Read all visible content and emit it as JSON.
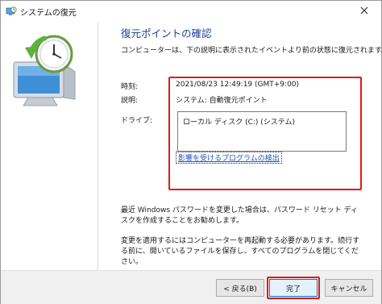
{
  "window": {
    "title": "システムの復元"
  },
  "heading": "復元ポイントの確認",
  "intro": "コンピューターは、下の説明に表示されたイベントより前の状態に復元されます。",
  "details": {
    "time_label": "時刻:",
    "time_value": "2021/08/23 12:49:19 (GMT+9:00)",
    "desc_label": "説明:",
    "desc_value": "システム: 自動復元ポイント",
    "drive_label": "ドライブ:",
    "drives": [
      "ローカル ディスク (C:) (システム)"
    ],
    "affected_link": "影響を受けるプログラムの検出"
  },
  "notes": {
    "password": "最近 Windows パスワードを変更した場合は、パスワード リセット ディスクを作成することをお勧めします。",
    "restart": "変更を適用するにはコンピューターを再起動する必要があります。続行する前に、開いているファイルを保存し、すべてのプログラムを閉じてください。"
  },
  "buttons": {
    "back": "< 戻る(B)",
    "finish": "完了",
    "cancel": "キャンセル"
  },
  "icons": {
    "title": "system-restore-icon",
    "close": "close-icon",
    "wizard": "system-restore-wizard-icon"
  },
  "colors": {
    "heading": "#1c3f94",
    "highlight": "#e11a1a",
    "link": "#1a55c6",
    "default_button_border": "#0078d7"
  }
}
